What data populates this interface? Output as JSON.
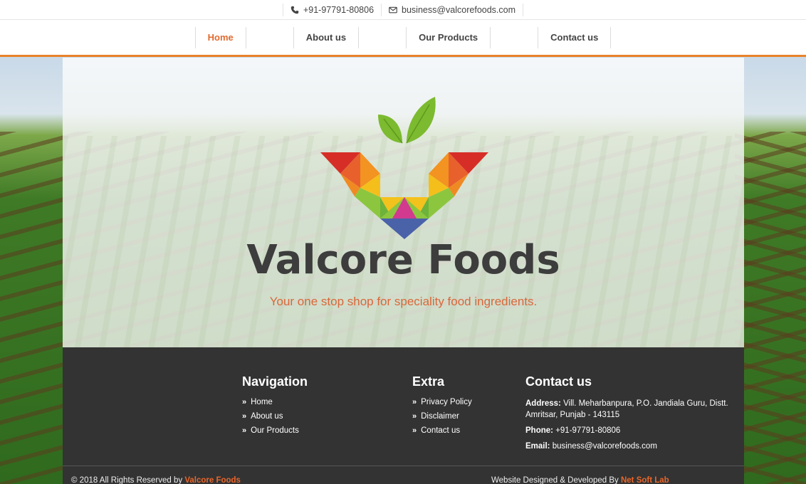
{
  "topbar": {
    "phone": "+91-97791-80806",
    "email": "business@valcorefoods.com",
    "phone_icon": "phone-icon",
    "email_icon": "envelope-icon"
  },
  "nav": {
    "items": [
      {
        "label": "Home",
        "active": true
      },
      {
        "label": "About us",
        "active": false
      },
      {
        "label": "Our Products",
        "active": false
      },
      {
        "label": "Contact us",
        "active": false
      }
    ]
  },
  "hero": {
    "brand": "Valcore Foods",
    "tagline": "Your one stop shop for speciality food ingredients."
  },
  "footer": {
    "navigation": {
      "title": "Navigation",
      "links": [
        "Home",
        "About us",
        "Our Products"
      ]
    },
    "extra": {
      "title": "Extra",
      "links": [
        "Privacy Policy",
        "Disclaimer",
        "Contact us"
      ]
    },
    "contact": {
      "title": "Contact us",
      "address_label": "Address:",
      "address": "Vill. Meharbanpura, P.O. Jandiala Guru, Distt. Amritsar, Punjab - 143115",
      "phone_label": "Phone:",
      "phone": "+91-97791-80806",
      "email_label": "Email:",
      "email": "business@valcorefoods.com"
    },
    "copyright_prefix": "© 2018 All Rights Reserved by",
    "copyright_brand": "Valcore Foods",
    "credit_prefix": "Website Designed & Developed By",
    "credit_brand": "Net Soft Lab"
  },
  "colors": {
    "accent": "#e8822a",
    "footer_bg": "#333333",
    "brand_text": "#3d3d3d",
    "tagline": "#d9673a"
  }
}
